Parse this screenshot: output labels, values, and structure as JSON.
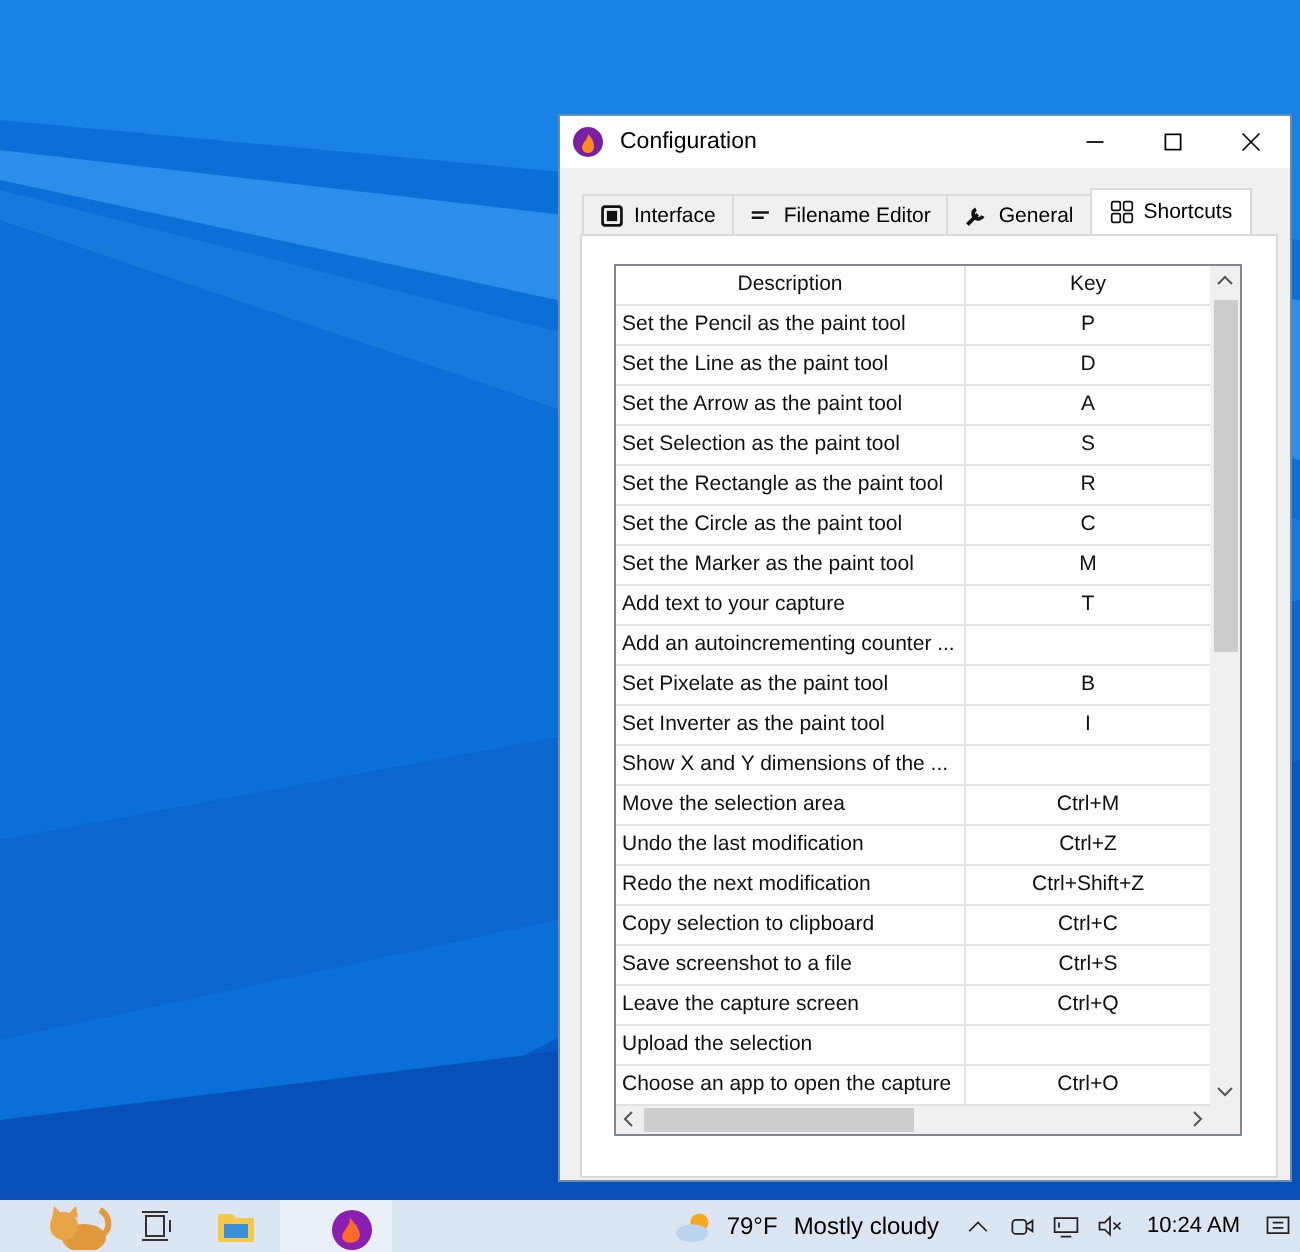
{
  "window": {
    "title": "Configuration"
  },
  "tabs": [
    {
      "label": "Interface",
      "selected": false
    },
    {
      "label": "Filename Editor",
      "selected": false
    },
    {
      "label": "General",
      "selected": false
    },
    {
      "label": "Shortcuts",
      "selected": true
    }
  ],
  "table": {
    "columns": [
      "Description",
      "Key"
    ],
    "rows": [
      [
        "Set the Pencil as the paint tool",
        "P"
      ],
      [
        "Set the Line as the paint tool",
        "D"
      ],
      [
        "Set the Arrow as the paint tool",
        "A"
      ],
      [
        "Set Selection as the paint tool",
        "S"
      ],
      [
        "Set the Rectangle as the paint tool",
        "R"
      ],
      [
        "Set the Circle as the paint tool",
        "C"
      ],
      [
        "Set the Marker as the paint tool",
        "M"
      ],
      [
        "Add text to your capture",
        "T"
      ],
      [
        "Add an autoincrementing counter ...",
        ""
      ],
      [
        "Set Pixelate as the paint tool",
        "B"
      ],
      [
        "Set Inverter as the paint tool",
        "I"
      ],
      [
        "Show X and Y dimensions of the ...",
        ""
      ],
      [
        "Move the selection area",
        "Ctrl+M"
      ],
      [
        "Undo the last modification",
        "Ctrl+Z"
      ],
      [
        "Redo the next modification",
        "Ctrl+Shift+Z"
      ],
      [
        "Copy selection to clipboard",
        "Ctrl+C"
      ],
      [
        "Save screenshot to a file",
        "Ctrl+S"
      ],
      [
        "Leave the capture screen",
        "Ctrl+Q"
      ],
      [
        "Upload the selection",
        ""
      ],
      [
        "Choose an app to open the capture",
        "Ctrl+O"
      ]
    ]
  },
  "taskbar": {
    "weather": {
      "temperature": "79°F",
      "condition": "Mostly cloudy"
    },
    "time": "10:24 AM"
  }
}
